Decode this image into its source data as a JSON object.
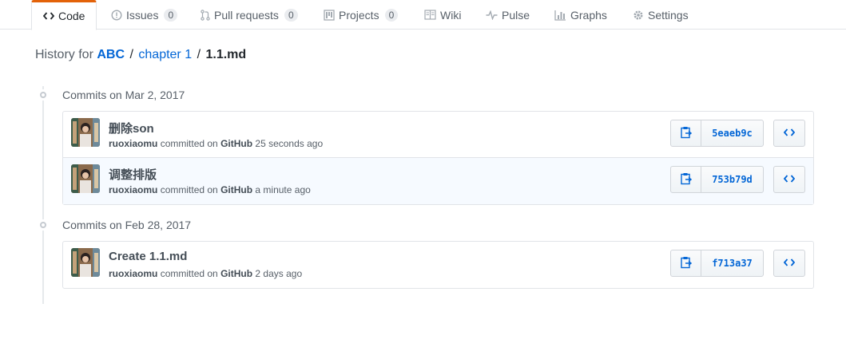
{
  "tabs": [
    {
      "label": "Code",
      "icon": "code-icon"
    },
    {
      "label": "Issues",
      "icon": "issue-opened-icon",
      "count": "0"
    },
    {
      "label": "Pull requests",
      "icon": "git-pull-request-icon",
      "count": "0"
    },
    {
      "label": "Projects",
      "icon": "project-icon",
      "count": "0"
    },
    {
      "label": "Wiki",
      "icon": "book-icon"
    },
    {
      "label": "Pulse",
      "icon": "pulse-icon"
    },
    {
      "label": "Graphs",
      "icon": "graph-icon"
    },
    {
      "label": "Settings",
      "icon": "gear-icon"
    }
  ],
  "breadcrumb": {
    "prefix": "History for",
    "repo": "ABC",
    "sep1": "/",
    "folder": "chapter 1",
    "sep2": "/",
    "file": "1.1.md"
  },
  "groups": [
    {
      "title": "Commits on Mar 2, 2017",
      "commits": [
        {
          "message": "删除son",
          "author": "ruoxiaomu",
          "committed_text": "committed on",
          "committer": "GitHub",
          "time": "25 seconds ago",
          "sha": "5eaeb9c"
        },
        {
          "message": "调整排版",
          "author": "ruoxiaomu",
          "committed_text": "committed on",
          "committer": "GitHub",
          "time": "a minute ago",
          "sha": "753b79d"
        }
      ]
    },
    {
      "title": "Commits on Feb 28, 2017",
      "commits": [
        {
          "message": "Create 1.1.md",
          "author": "ruoxiaomu",
          "committed_text": "committed on",
          "committer": "GitHub",
          "time": "2 days ago",
          "sha": "f713a37"
        }
      ]
    }
  ],
  "colors": {
    "link": "#0366d6",
    "selected_tab_accent": "#e36209",
    "highlight_row": "#f6faff"
  }
}
